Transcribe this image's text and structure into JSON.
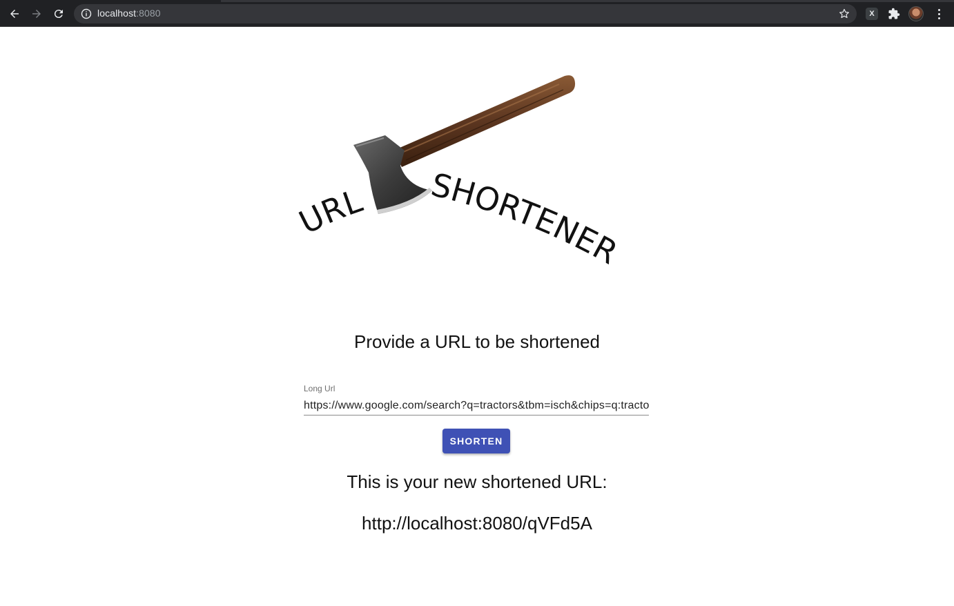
{
  "browser": {
    "url_host": "localhost",
    "url_port": ":8080",
    "extension_badge": "X"
  },
  "logo": {
    "word_left": "URL",
    "word_right": "SHORTENER"
  },
  "main": {
    "heading": "Provide a URL to be shortened",
    "input_label": "Long Url",
    "input_value": "https://www.google.com/search?q=tractors&tbm=isch&chips=q:tractors",
    "shorten_label": "SHORTEN",
    "result_title": "This is your new shortened URL:",
    "result_url": "http://localhost:8080/qVFd5A"
  },
  "colors": {
    "primary_button": "#3f51b5",
    "browser_bar": "#202124",
    "omnibox": "#35363a"
  }
}
